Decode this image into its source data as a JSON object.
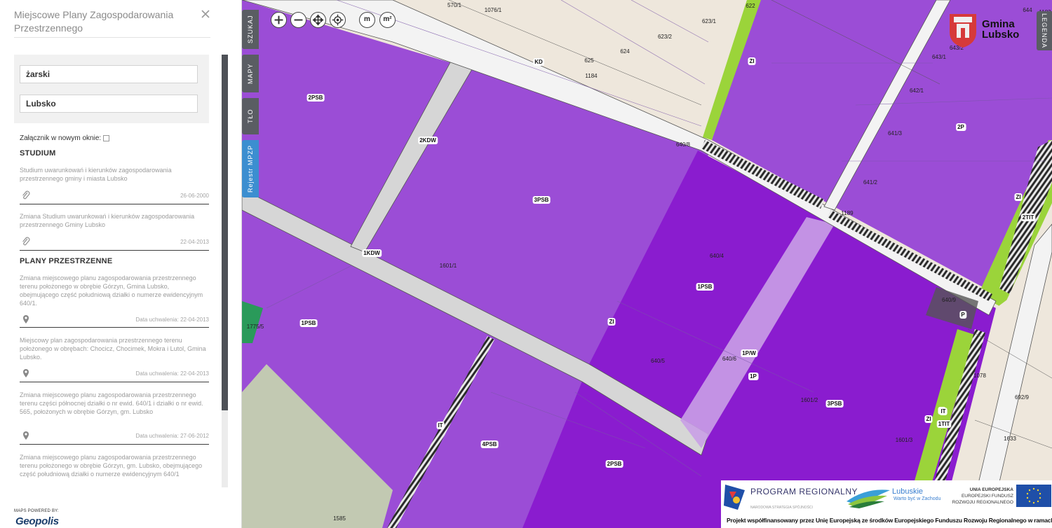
{
  "sidebar": {
    "title": "Miejscowe Plany Zagospodarowania Przestrzennego",
    "search": {
      "gmina_value": "żarski",
      "miasto_value": "Lubsko"
    },
    "new_window_label": "Załącznik w nowym oknie:",
    "sections": [
      {
        "heading": "STUDIUM",
        "items": [
          {
            "text": "Studium uwarunkowań i kierunków zagospodarowania przestrzennego gminy i miasta Lubsko",
            "icon": "paperclip-icon",
            "date": "26-06-2000"
          },
          {
            "text": "Zmiana Studium uwarunkowań i kierunków zagospodarowania przestrzennego Gminy Lubsko",
            "icon": "paperclip-icon",
            "date": "22-04-2013"
          }
        ]
      },
      {
        "heading": "PLANY PRZESTRZENNE",
        "items": [
          {
            "text": "Zmiana miejscowego planu zagospodarowania przestrzennego terenu położonego w obrębie Górzyn, Gmina Lubsko, obejmującego część południową działki o numerze ewidencyjnym 640/1.",
            "icon": "map-pin-icon",
            "date": "Data uchwalenia: 22-04-2013"
          },
          {
            "text": "Miejscowy plan zagospodarowania przestrzennego terenu położonego w obrębach: Chocicz, Chocimek, Mokra i Lutol, Gmina Lubsko.",
            "icon": "map-pin-icon",
            "date": "Data uchwalenia: 22-04-2013"
          },
          {
            "text": "Zmiana miejscowego planu zagospodarowania przestrzennego terenu części północnej działki o nr ewid. 640/1 i działki o nr ewid. 565, położonych w obrębie Górzyn, gm. Lubsko",
            "icon": "map-pin-icon",
            "date": "Data uchwalenia: 27-06-2012"
          },
          {
            "text": "Zmiana miejscowego planu zagospodarowania przestrzennego terenu położonego w obrębie Górzyn, gm. Lubsko, obejmującego część południową działki o numerze ewidencyjnym 640/1",
            "icon": "map-pin-icon",
            "date": ""
          }
        ]
      }
    ],
    "powered_by": "MAPS POWERED BY:",
    "logo": "Geopolis"
  },
  "map": {
    "tabs_left": [
      "SZUKAJ",
      "MAPY",
      "TŁO",
      "Rejestr MPZP"
    ],
    "tab_right": "LEGENDA",
    "tools": [
      "zoom-in-icon",
      "zoom-out-icon",
      "pan-icon",
      "locate-icon"
    ],
    "measure": [
      "m",
      "m²"
    ],
    "brand": "Gmina Lubsko",
    "zone_labels": [
      "2PSB",
      "2KDW",
      "3PSB",
      "1KDW",
      "1PSB",
      "1PSB",
      "4PSB",
      "2PSB",
      "1P",
      "3PSB",
      "2P",
      "1P/W",
      "KD",
      "ZI",
      "ZI",
      "ZI",
      "ZI",
      "ZI",
      "IT",
      "IT",
      "1TIT",
      "2TIT",
      "P"
    ],
    "parcel_labels": [
      "570/1",
      "1183",
      "1076/1",
      "622",
      "623/1",
      "623/2",
      "625",
      "624",
      "1184",
      "640/8",
      "643/2",
      "643/1",
      "642/1",
      "641/3",
      "641/2",
      "644",
      "1189",
      "640/4",
      "1601/1",
      "640/5",
      "640/6",
      "1601/2",
      "1601/3",
      "640/9",
      "1078",
      "692/9",
      "1633",
      "1775/5",
      "1585"
    ],
    "colors": {
      "purple": "#9b4dd6",
      "violet": "#8a1ccf",
      "road": "#d6d6d6",
      "green": "#9bd43a",
      "land": "#eee7dc",
      "hatch": "#2b2b2b"
    },
    "sponsor": {
      "program": "PROGRAM REGIONALNY",
      "program_sub": "NARODOWA STRATEGIA SPÓJNOŚCI",
      "region": "Lubuskie",
      "region_sub": "Warto być w Zachodu",
      "eu_heading": "UNIA EUROPEJSKA",
      "eu_fund": "EUROPEJSKI FUNDUSZ ROZWOJU REGIONALNEGO",
      "footer": "Projekt współfinansowany przez Unię Europejską ze środków Europejskiego Funduszu Rozwoju Regionalnego w ramach"
    }
  }
}
